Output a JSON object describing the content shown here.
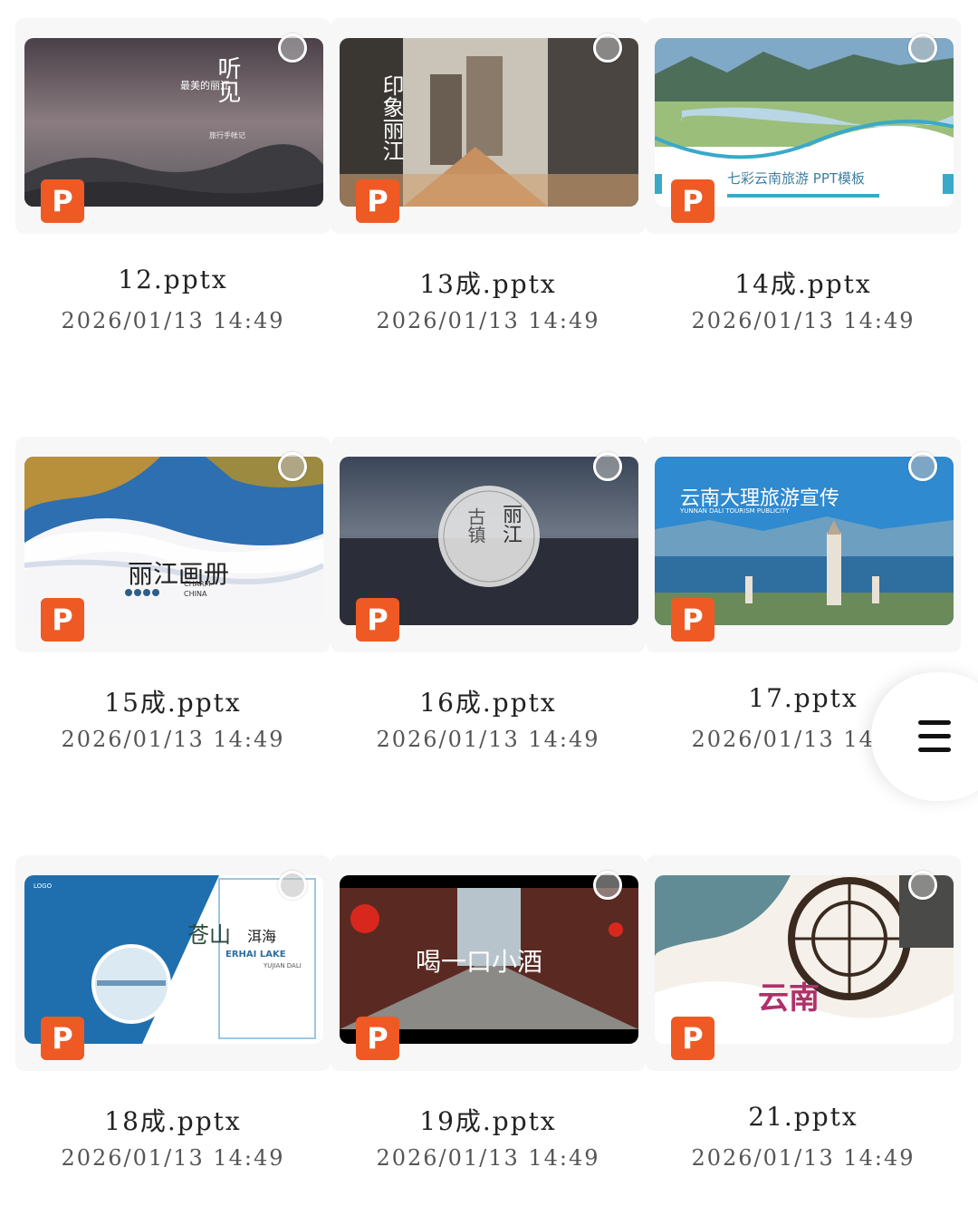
{
  "files": [
    {
      "name": "12.pptx",
      "date": "2026/01/13 14:49",
      "thumb_text": [
        "听见",
        "最美的丽江",
        "旅行手帐记"
      ]
    },
    {
      "name": "13成.pptx",
      "date": "2026/01/13 14:49",
      "thumb_text": [
        "印象丽江"
      ]
    },
    {
      "name": "14成.pptx",
      "date": "2026/01/13 14:49",
      "thumb_text": [
        "七彩云南旅游 PPT模板"
      ]
    },
    {
      "name": "15成.pptx",
      "date": "2026/01/13 14:49",
      "thumb_text": [
        "丽江画册",
        "CHARM",
        "CHINA"
      ]
    },
    {
      "name": "16成.pptx",
      "date": "2026/01/13 14:49",
      "thumb_text": [
        "丽江",
        "古镇"
      ]
    },
    {
      "name": "17.pptx",
      "date": "2026/01/13 14:49",
      "thumb_text": [
        "云南大理旅游宣传",
        "YUNNAN DALI TOURISM PUBLICITY"
      ]
    },
    {
      "name": "18成.pptx",
      "date": "2026/01/13 14:49",
      "thumb_text": [
        "苍山",
        "洱海",
        "ERHAI LAKE",
        "YUJIAN DALI",
        "LOGO"
      ]
    },
    {
      "name": "19成.pptx",
      "date": "2026/01/13 14:49",
      "thumb_text": [
        "喝一口小酒"
      ]
    },
    {
      "name": "21.pptx",
      "date": "2026/01/13 14:49",
      "thumb_text": [
        "云南"
      ]
    }
  ],
  "badge_label": "P",
  "icons": {
    "file_type": "powerpoint-icon",
    "select": "select-circle-icon",
    "menu": "hamburger-menu-icon"
  },
  "colors": {
    "ppt_badge": "#ef5a24",
    "background": "#ffffff"
  }
}
